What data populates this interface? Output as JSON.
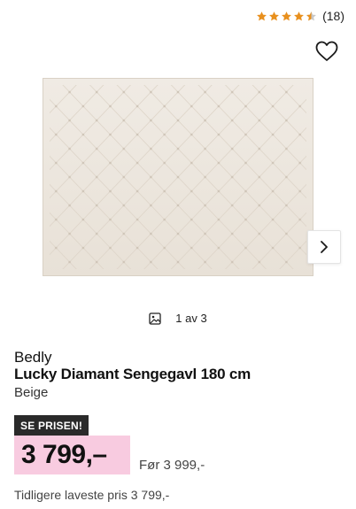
{
  "rating": {
    "stars": 4.5,
    "count_label": "(18)",
    "star_color": "#e8901e",
    "empty_star_color": "#c8c8c8"
  },
  "gallery": {
    "indicator": "1 av 3"
  },
  "product": {
    "brand": "Bedly",
    "name": "Lucky Diamant Sengegavl 180 cm",
    "variant": "Beige",
    "color_swatch": "#ece6dd"
  },
  "pricing": {
    "badge": "SE PRISEN!",
    "price": "3 799,–",
    "before_price": "Før 3 999,-",
    "lowest_price": "Tidligere laveste pris 3 799,-",
    "highlight_color": "#f8cbe0"
  }
}
